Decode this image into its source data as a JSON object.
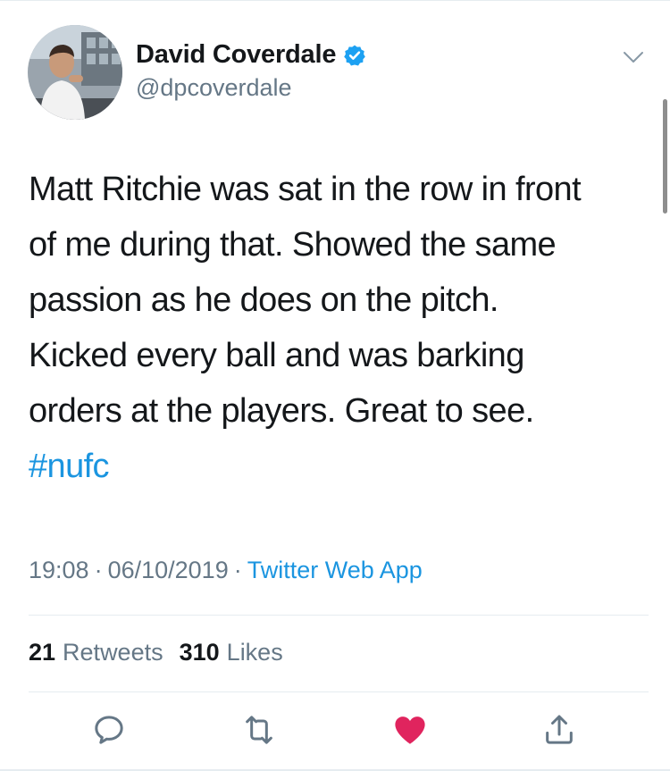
{
  "tweet": {
    "author": {
      "display_name": "David Coverdale",
      "handle": "@dpcoverdale",
      "verified": true,
      "avatar_icon": "user-avatar-photo"
    },
    "menu_icon": "chevron-down-icon",
    "text": "Matt Ritchie was sat in the row in front\nof me during that. Showed the same\npassion as he does on the pitch.\nKicked every ball and was barking\norders at the players. Great to see.",
    "hashtag": "#nufc",
    "time": "19:08",
    "separator_1": "·",
    "date": "06/10/2019",
    "separator_2": "·",
    "source": "Twitter Web App",
    "retweets_count": "21",
    "retweets_label": "Retweets",
    "likes_count": "310",
    "likes_label": "Likes",
    "liked": true
  },
  "actions": [
    {
      "name": "reply",
      "icon": "reply-icon"
    },
    {
      "name": "retweet",
      "icon": "retweet-icon"
    },
    {
      "name": "like",
      "icon": "heart-icon"
    },
    {
      "name": "share",
      "icon": "share-icon"
    }
  ],
  "colors": {
    "link": "#1b95e0",
    "secondary_text": "#657786",
    "primary_text": "#14171a",
    "like_active": "#e0245e",
    "divider": "#e6ecf0"
  }
}
